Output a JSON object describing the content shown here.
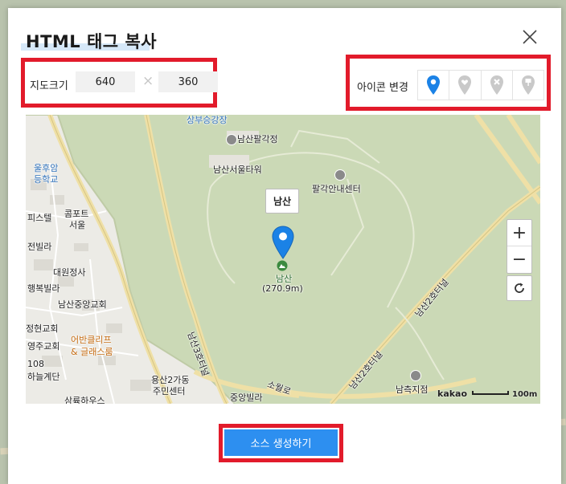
{
  "dialog": {
    "title": "HTML 태그 복사"
  },
  "size": {
    "label": "지도크기",
    "width": "640",
    "height": "360",
    "separator": "×"
  },
  "icon_change": {
    "label": "아이콘 변경",
    "options": [
      {
        "icon": "map-pin-icon",
        "selected": true
      },
      {
        "icon": "heart-pin-icon",
        "selected": false
      },
      {
        "icon": "x-pin-icon",
        "selected": false
      },
      {
        "icon": "flag-pin-icon",
        "selected": false
      }
    ]
  },
  "map": {
    "place_tag": "남산",
    "labels": {
      "top_partial": "상부승강장",
      "palgakjeong": "남산팔각정",
      "tower": "남산서울타워",
      "info_center": "팔각안내센터",
      "namsan": "남산",
      "elevation": "(270.9m)",
      "school_1": "울후암",
      "school_2": "등학교",
      "pistel": "피스텔",
      "comfort_1": "콤포트",
      "comfort_2": "서울",
      "villa": "전빌라",
      "daewon": "대원정사",
      "haengbok": "행복빌라",
      "namsan_church": "남산중앙교회",
      "jeonghyun": "정현교회",
      "club_1": "어반클리프",
      "club_2": "& 글래스룸",
      "yeongju": "영주교회",
      "num108": "108",
      "stairs": "하늘계단",
      "yongsan_1": "용산2가동",
      "yongsan_2": "주민센터",
      "jungang_villa": "중앙빌라",
      "sorwol": "소월로",
      "namcheuk": "남측지점",
      "samyook": "삼륙하우스",
      "road_3": "남산3호터널",
      "road_2": "남산2호터널",
      "road_2b": "남산2호터널"
    },
    "copyright": "kakao",
    "scale": "100m",
    "zoom_in": "+",
    "zoom_out": "−"
  },
  "actions": {
    "generate": "소스 생성하기"
  },
  "colors": {
    "highlight_border": "#e21b2b",
    "primary_button": "#2d8ff0",
    "marker": "#1b82e6",
    "map_bg": "#cbd9b6"
  }
}
